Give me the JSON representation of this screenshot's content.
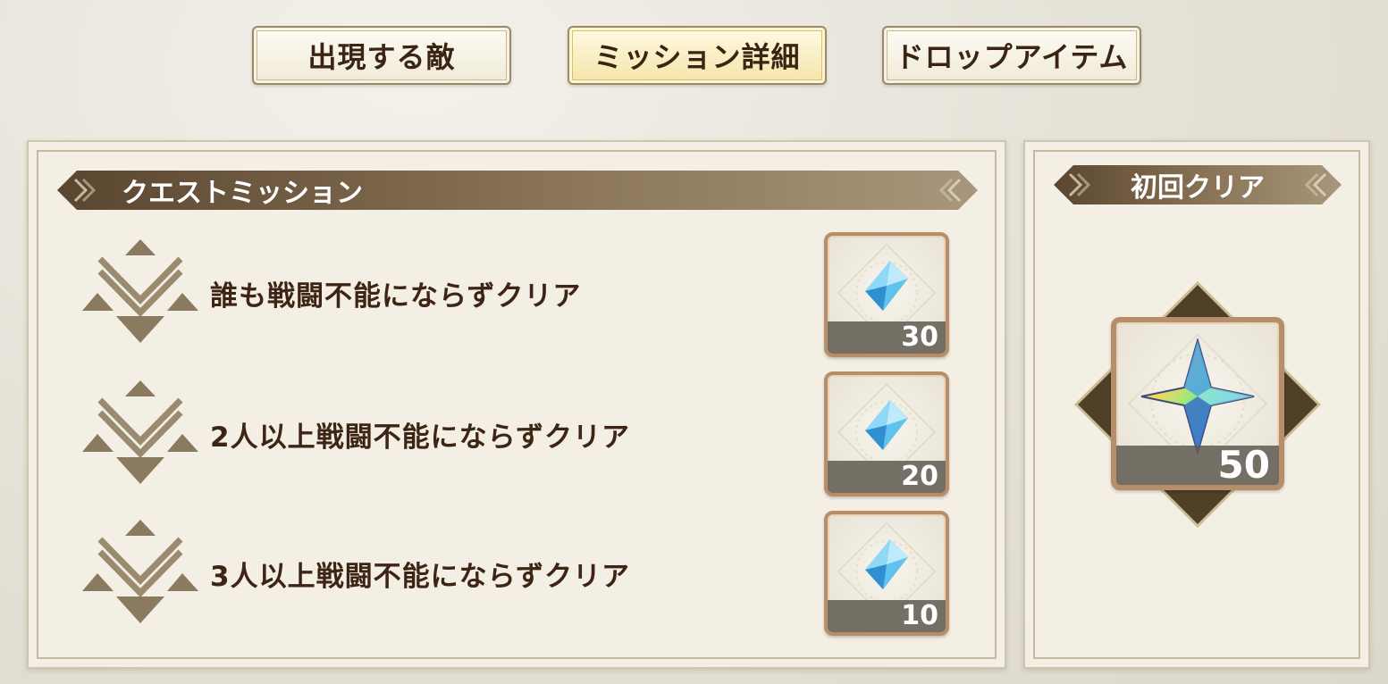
{
  "tabs": [
    {
      "label": "出現する敵",
      "active": false
    },
    {
      "label": "ミッション詳細",
      "active": true
    },
    {
      "label": "ドロップアイテム",
      "active": false
    }
  ],
  "quest_missions": {
    "header": "クエストミッション",
    "items": [
      {
        "text": "誰も戦闘不能にならずクリア",
        "reward_icon": "crystal-icon",
        "reward_qty": "30"
      },
      {
        "text": "2人以上戦闘不能にならずクリア",
        "reward_icon": "crystal-icon",
        "reward_qty": "20"
      },
      {
        "text": "3人以上戦闘不能にならずクリア",
        "reward_icon": "crystal-icon",
        "reward_qty": "10"
      }
    ]
  },
  "first_clear": {
    "header": "初回クリア",
    "reward_icon": "rainbow-crystal-icon",
    "reward_qty": "50"
  },
  "colors": {
    "text_dark_brown": "#3e2414",
    "banner_brown": "#5a4530",
    "frame_copper": "#b68e6a",
    "crystal_blue": "#5fc3ee"
  }
}
